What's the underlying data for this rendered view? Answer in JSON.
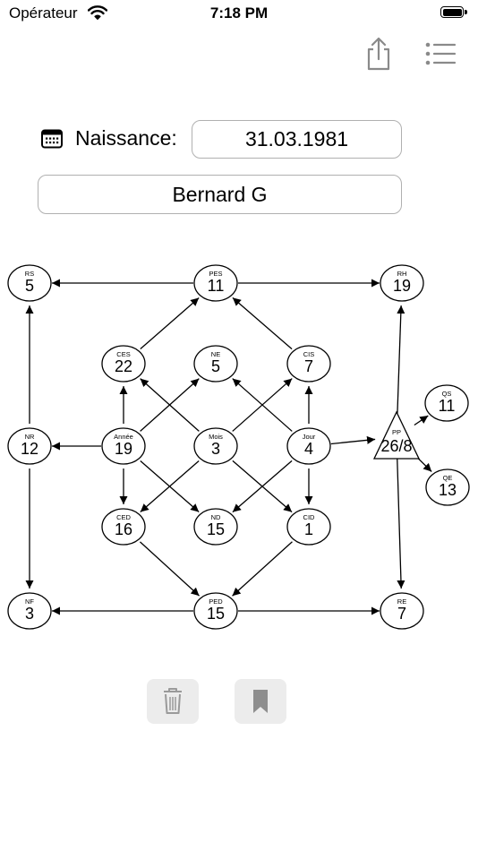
{
  "status_bar": {
    "carrier": "Opérateur",
    "time": "7:18 PM"
  },
  "toolbar": {
    "share_icon": "share-icon",
    "list_icon": "list-icon"
  },
  "form": {
    "birth_label": "Naissance:",
    "birth_date": "31.03.1981",
    "name": "Bernard G"
  },
  "diagram": {
    "nodes": [
      {
        "id": "RS",
        "label": "RS",
        "value": "5"
      },
      {
        "id": "PES",
        "label": "PES",
        "value": "11"
      },
      {
        "id": "RH",
        "label": "RH",
        "value": "19"
      },
      {
        "id": "CES",
        "label": "CES",
        "value": "22"
      },
      {
        "id": "NE",
        "label": "NE",
        "value": "5"
      },
      {
        "id": "CIS",
        "label": "CIS",
        "value": "7"
      },
      {
        "id": "QS",
        "label": "QS",
        "value": "11"
      },
      {
        "id": "NR",
        "label": "NR",
        "value": "12"
      },
      {
        "id": "Annee",
        "label": "Année",
        "value": "19"
      },
      {
        "id": "Mois",
        "label": "Mois",
        "value": "3"
      },
      {
        "id": "Jour",
        "label": "Jour",
        "value": "4"
      },
      {
        "id": "PP",
        "label": "PP",
        "value": "26/8"
      },
      {
        "id": "QE",
        "label": "QE",
        "value": "13"
      },
      {
        "id": "CED",
        "label": "CED",
        "value": "16"
      },
      {
        "id": "ND",
        "label": "ND",
        "value": "15"
      },
      {
        "id": "CID",
        "label": "CID",
        "value": "1"
      },
      {
        "id": "NF",
        "label": "NF",
        "value": "3"
      },
      {
        "id": "PED",
        "label": "PED",
        "value": "15"
      },
      {
        "id": "RE",
        "label": "RE",
        "value": "7"
      }
    ],
    "edges": [
      [
        "PES",
        "RS"
      ],
      [
        "PES",
        "RH"
      ],
      [
        "NR",
        "RS"
      ],
      [
        "PP",
        "RH"
      ],
      [
        "CES",
        "PES"
      ],
      [
        "CIS",
        "PES"
      ],
      [
        "Annee",
        "CES"
      ],
      [
        "Annee",
        "NE"
      ],
      [
        "Annee",
        "NR"
      ],
      [
        "Annee",
        "CED"
      ],
      [
        "Annee",
        "ND"
      ],
      [
        "Mois",
        "CES"
      ],
      [
        "Mois",
        "CIS"
      ],
      [
        "Mois",
        "CED"
      ],
      [
        "Mois",
        "CID"
      ],
      [
        "Jour",
        "NE"
      ],
      [
        "Jour",
        "CIS"
      ],
      [
        "Jour",
        "PP"
      ],
      [
        "Jour",
        "ND"
      ],
      [
        "Jour",
        "CID"
      ],
      [
        "PP",
        "QS"
      ],
      [
        "PP",
        "QE"
      ],
      [
        "PP",
        "RE"
      ],
      [
        "NR",
        "NF"
      ],
      [
        "CED",
        "PED"
      ],
      [
        "CID",
        "PED"
      ],
      [
        "PED",
        "NF"
      ],
      [
        "PED",
        "RE"
      ]
    ]
  },
  "actions": {
    "delete_icon": "trash-icon",
    "bookmark_icon": "bookmark-icon"
  }
}
